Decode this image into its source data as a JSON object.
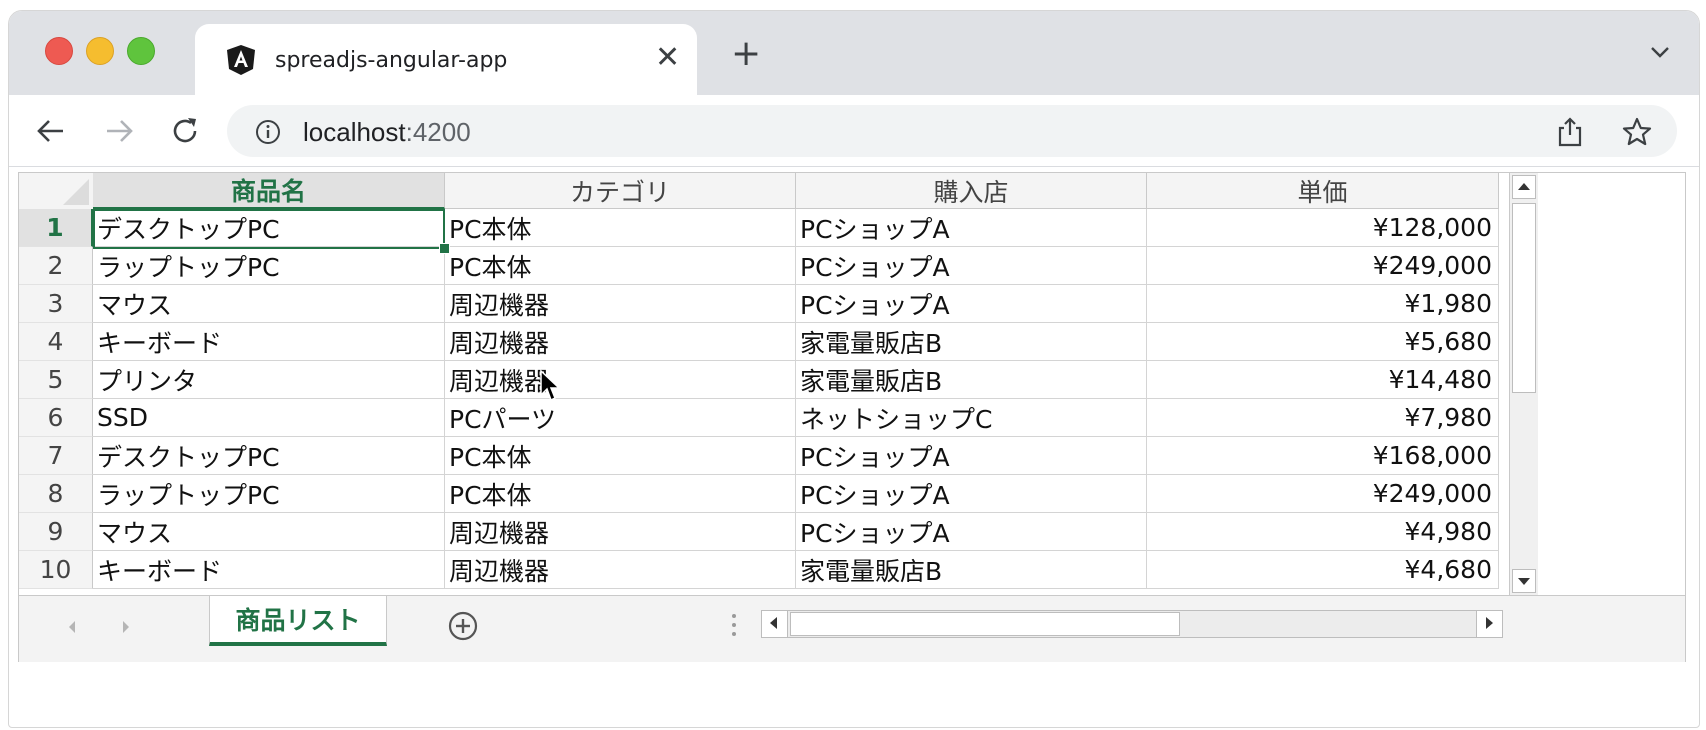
{
  "browser": {
    "tab_title": "spreadjs-angular-app",
    "url_host": "localhost",
    "url_port": ":4200"
  },
  "sheet": {
    "columns": [
      "商品名",
      "カテゴリ",
      "購入店",
      "単価"
    ],
    "active_column": "商品名",
    "active_row": 1,
    "rows": [
      {
        "n": "1",
        "name": "デスクトップPC",
        "category": "PC本体",
        "store": "PCショップA",
        "price": "¥128,000"
      },
      {
        "n": "2",
        "name": "ラップトップPC",
        "category": "PC本体",
        "store": "PCショップA",
        "price": "¥249,000"
      },
      {
        "n": "3",
        "name": "マウス",
        "category": "周辺機器",
        "store": "PCショップA",
        "price": "¥1,980"
      },
      {
        "n": "4",
        "name": "キーボード",
        "category": "周辺機器",
        "store": "家電量販店B",
        "price": "¥5,680"
      },
      {
        "n": "5",
        "name": "プリンタ",
        "category": "周辺機器",
        "store": "家電量販店B",
        "price": "¥14,480"
      },
      {
        "n": "6",
        "name": "SSD",
        "category": "PCパーツ",
        "store": "ネットショップC",
        "price": "¥7,980"
      },
      {
        "n": "7",
        "name": "デスクトップPC",
        "category": "PC本体",
        "store": "PCショップA",
        "price": "¥168,000"
      },
      {
        "n": "8",
        "name": "ラップトップPC",
        "category": "PC本体",
        "store": "PCショップA",
        "price": "¥249,000"
      },
      {
        "n": "9",
        "name": "マウス",
        "category": "周辺機器",
        "store": "PCショップA",
        "price": "¥4,980"
      },
      {
        "n": "10",
        "name": "キーボード",
        "category": "周辺機器",
        "store": "家電量販店B",
        "price": "¥4,680"
      }
    ],
    "sheet_tab": "商品リスト"
  },
  "colors": {
    "accent": "#217346",
    "chrome_bg": "#dfe1e5"
  }
}
